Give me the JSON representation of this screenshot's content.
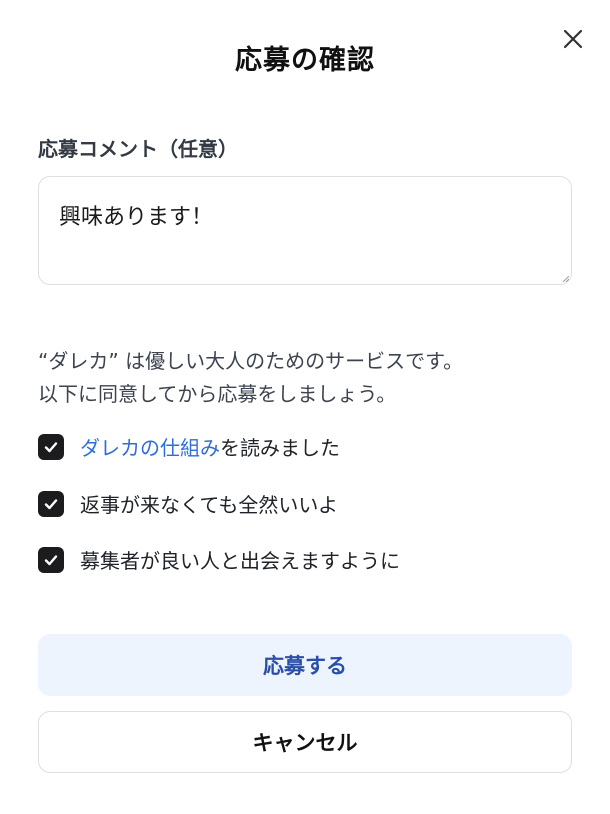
{
  "dialog": {
    "title": "応募の確認",
    "close_icon": "close-icon"
  },
  "comment": {
    "label": "応募コメント（任意）",
    "value": "興味あります！"
  },
  "notice": {
    "line1": "“ダレカ” は優しい大人のためのサービスです。",
    "line2": "以下に同意してから応募をしましょう。"
  },
  "agreements": [
    {
      "checked": true,
      "link_text": "ダレカの仕組み",
      "text": "を読みました"
    },
    {
      "checked": true,
      "text": "返事が来なくても全然いいよ"
    },
    {
      "checked": true,
      "text": "募集者が良い人と出会えますように"
    }
  ],
  "buttons": {
    "apply_label": "応募する",
    "cancel_label": "キャンセル"
  },
  "colors": {
    "link": "#2f6ed6",
    "primary_button_bg": "#eef4fd",
    "primary_button_text": "#2a4fa8",
    "checkbox": "#1c1c1e"
  }
}
